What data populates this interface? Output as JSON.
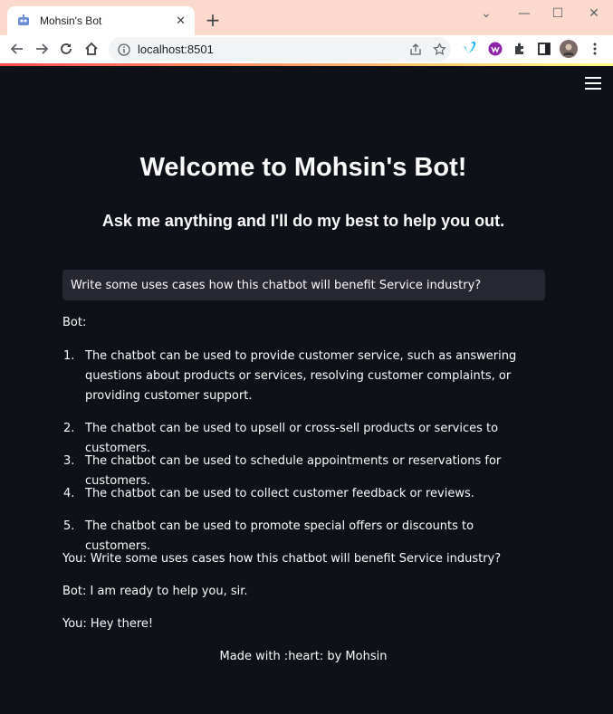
{
  "browser": {
    "tab_title": "Mohsin's Bot",
    "tab_close": "✕",
    "new_tab": "+",
    "url": "localhost:8501",
    "window_controls": {
      "collapse": "⌄",
      "minimize": "—",
      "maximize": "☐",
      "close": "✕"
    },
    "extension_icons": [
      "vimeo-icon",
      "extension-purple-icon",
      "puzzle-icon",
      "sidebar-icon",
      "profile-avatar",
      "more-menu-icon"
    ]
  },
  "page": {
    "title": "Welcome to Mohsin's Bot!",
    "subtitle": "Ask me anything and I'll do my best to help you out.",
    "input_value": "Write some uses cases how this chatbot will benefit Service industry?",
    "bot_label": "Bot:",
    "response_items": [
      {
        "num": "1.",
        "text": "The chatbot can be used to provide customer service, such as answering questions about products or services, resolving customer complaints, or providing customer support."
      },
      {
        "num": "2.",
        "text": "The chatbot can be used to upsell or cross-sell products or services to customers."
      },
      {
        "num": "3.",
        "text": "The chatbot can be used to schedule appointments or reservations for customers."
      },
      {
        "num": "4.",
        "text": "The chatbot can be used to collect customer feedback or reviews."
      },
      {
        "num": "5.",
        "text": "The chatbot can be used to promote special offers or discounts to customers."
      }
    ],
    "history": [
      "You: Write some uses cases how this chatbot will benefit Service industry?",
      "Bot: I am ready to help you, sir.",
      "You: Hey there!"
    ],
    "footer": "Made with :heart: by Mohsin"
  },
  "colors": {
    "chrome_bg": "#fbd9cd",
    "app_bg": "#0e1117",
    "input_bg": "#262730",
    "text": "#fafafa"
  }
}
